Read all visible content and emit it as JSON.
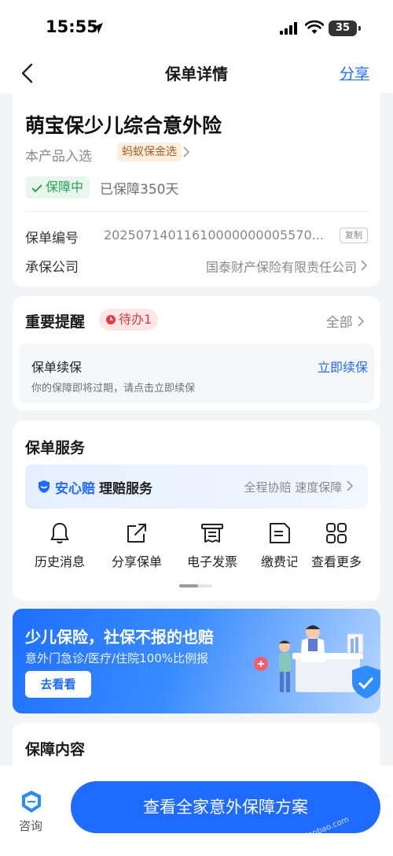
{
  "status_bar": {
    "time": "15:55",
    "battery": "35"
  },
  "header": {
    "title": "保单详情",
    "share": "分享"
  },
  "policy": {
    "product_name": "萌宝保少儿综合意外险",
    "selected_text": "本产品入选",
    "selected_tag": "蚂蚁保金选",
    "status": "保障中",
    "days": "已保障350天",
    "number_label": "保单编号",
    "number_value": "20250714011610000000005570...",
    "copy": "复制",
    "insurer_label": "承保公司",
    "insurer_value": "国泰财产保险有限责任公司"
  },
  "reminders": {
    "title": "重要提醒",
    "todo": "待办1",
    "all": "全部",
    "item_title": "保单续保",
    "item_action": "立即续保",
    "item_desc": "你的保障即将过期，请点击立即续保"
  },
  "services": {
    "title": "保单服务",
    "claim_brand": "安心赔",
    "claim_name": "理赔服务",
    "claim_tags": "全程协赔 速度保障",
    "items": [
      {
        "label": "历史消息",
        "icon": "bell-icon"
      },
      {
        "label": "分享保单",
        "icon": "share-icon"
      },
      {
        "label": "电子发票",
        "icon": "receipt-icon"
      },
      {
        "label": "缴费记",
        "icon": "payment-record-icon"
      },
      {
        "label": "查看更多",
        "icon": "grid-icon"
      }
    ]
  },
  "banner": {
    "title": "少儿保险，社保不报的也赔",
    "subtitle": "意外门急诊/医疗/住院100%比例报",
    "button": "去看看"
  },
  "coverage": {
    "title": "保障内容"
  },
  "bottom": {
    "consult": "咨询",
    "cta": "查看全家意外保障方案"
  },
  "watermark": "www.xianbao.com"
}
